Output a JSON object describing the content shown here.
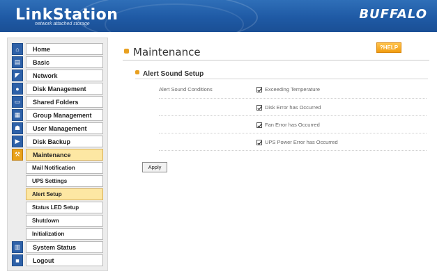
{
  "header": {
    "brand": "LinkStation",
    "tagline": "network attached storage",
    "logo": "BUFFALO"
  },
  "sidebar": {
    "items": [
      {
        "label": "Home",
        "icon": "home-icon"
      },
      {
        "label": "Basic",
        "icon": "basic-icon"
      },
      {
        "label": "Network",
        "icon": "network-icon"
      },
      {
        "label": "Disk Management",
        "icon": "disk-icon"
      },
      {
        "label": "Shared Folders",
        "icon": "folder-icon"
      },
      {
        "label": "Group Management",
        "icon": "group-icon"
      },
      {
        "label": "User Management",
        "icon": "user-icon"
      },
      {
        "label": "Disk Backup",
        "icon": "backup-icon"
      },
      {
        "label": "Maintenance",
        "icon": "wrench-icon",
        "active": true
      }
    ],
    "sub_items": [
      {
        "label": "Mail Notification"
      },
      {
        "label": "UPS Settings"
      },
      {
        "label": "Alert Setup",
        "active": true
      },
      {
        "label": "Status LED Setup"
      },
      {
        "label": "Shutdown"
      },
      {
        "label": "Initialization"
      }
    ],
    "bottom_items": [
      {
        "label": "System Status",
        "icon": "status-icon"
      },
      {
        "label": "Logout",
        "icon": "logout-icon"
      }
    ]
  },
  "main": {
    "title": "Maintenance",
    "help_label": "?HELP",
    "section_title": "Alert Sound Setup",
    "conditions_label": "Alert Sound Conditions",
    "conditions": [
      {
        "label": "Exceeding Temperature",
        "checked": true
      },
      {
        "label": "Disk Error has Occurred",
        "checked": true
      },
      {
        "label": "Fan Error has Occurred",
        "checked": true
      },
      {
        "label": "UPS Power Error has Occurred",
        "checked": true
      }
    ],
    "apply_label": "Apply"
  },
  "colors": {
    "header_blue": "#1f5aa5",
    "accent_orange": "#e9a21b",
    "active_highlight": "#fde7a3"
  }
}
